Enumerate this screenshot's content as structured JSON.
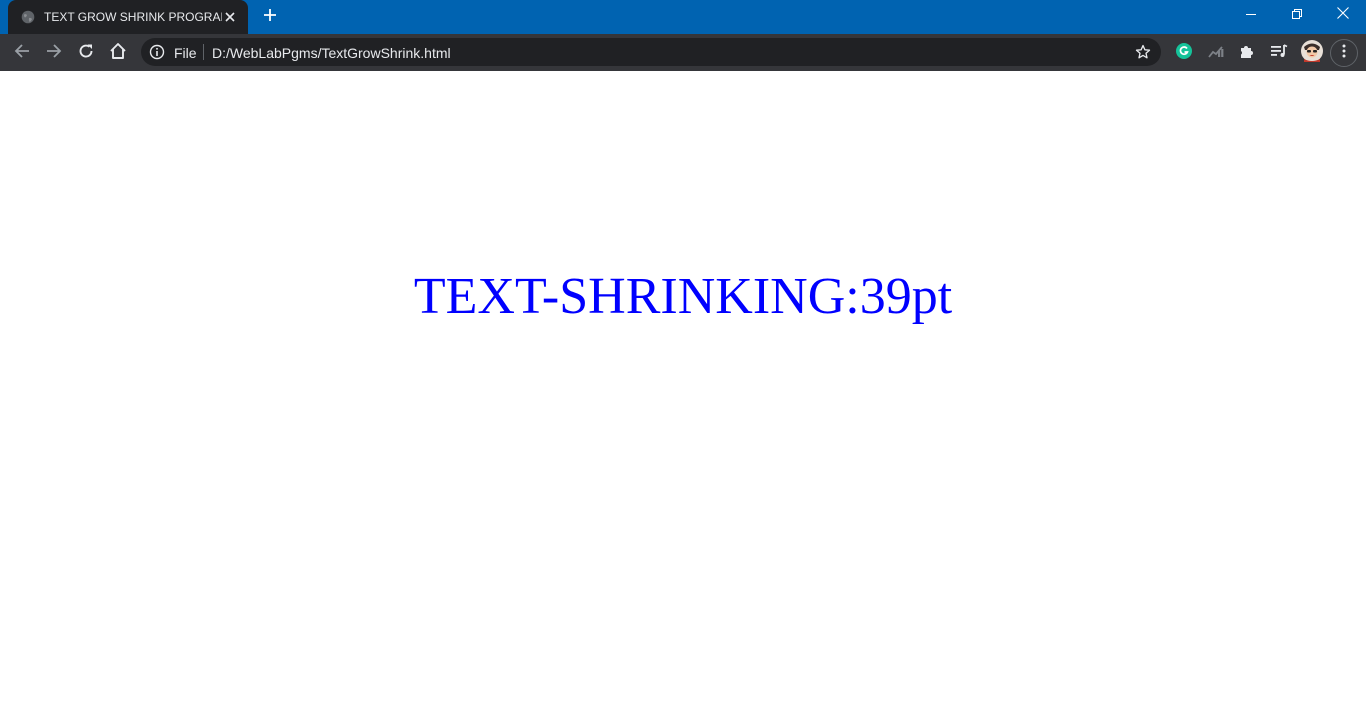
{
  "browser": {
    "tab": {
      "title": "TEXT GROW SHRINK PROGRAM",
      "favicon_icon": "globe-icon",
      "close_icon": "close-icon"
    },
    "new_tab_icon": "plus-icon",
    "window_controls": [
      "minimize-icon",
      "restore-icon",
      "close-icon"
    ],
    "toolbar": {
      "back_icon": "arrow-left-icon",
      "forward_icon": "arrow-right-icon",
      "reload_icon": "reload-icon",
      "home_icon": "home-icon"
    },
    "omnibox": {
      "info_icon": "info-icon",
      "scheme_label": "File",
      "url": "D:/WebLabPgms/TextGrowShrink.html",
      "bookmark_icon": "star-icon"
    },
    "extensions": [
      "grammarly-icon",
      "analytics-icon",
      "puzzle-icon",
      "media-playlist-icon",
      "profile-avatar",
      "kebab-menu-icon"
    ]
  },
  "page": {
    "display_text": "TEXT-SHRINKING:39pt",
    "text_color": "#0000ff"
  },
  "colors": {
    "titlebar": "#0063b1",
    "tab": "#202124",
    "toolbar": "#35363a",
    "omnibox": "#202124",
    "grammarly": "#15c39a"
  }
}
